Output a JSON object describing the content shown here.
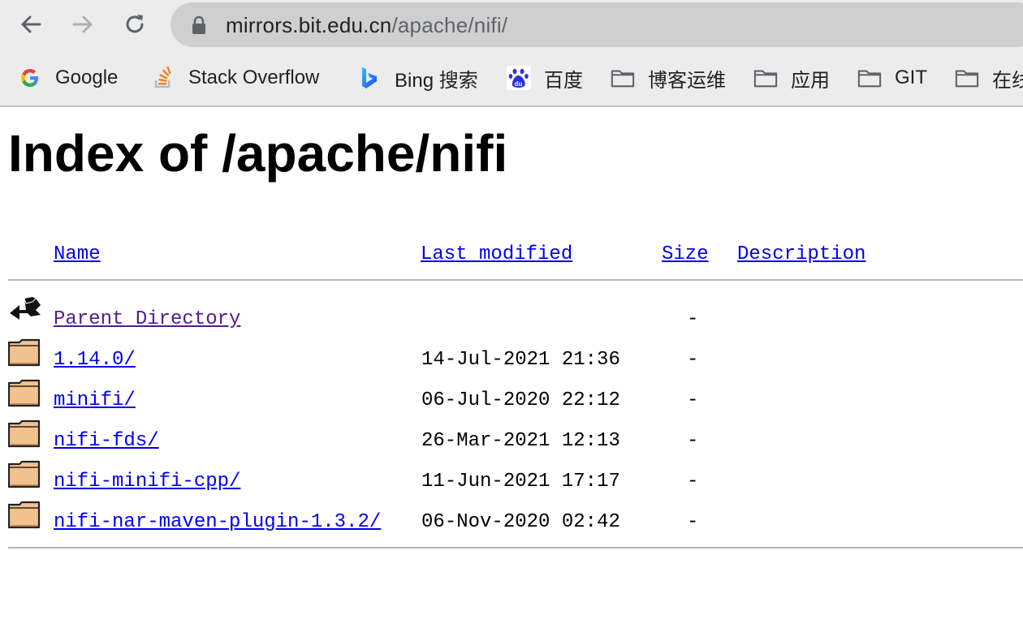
{
  "browser": {
    "url_host": "mirrors.bit.edu.cn",
    "url_path": "/apache/nifi/",
    "bookmarks": [
      {
        "label": "Google",
        "icon": "google-icon"
      },
      {
        "label": "Stack Overflow",
        "icon": "stackoverflow-icon"
      },
      {
        "label": "Bing 搜索",
        "icon": "bing-icon"
      },
      {
        "label": "百度",
        "icon": "baidu-icon"
      },
      {
        "label": "博客运维",
        "icon": "folder-icon"
      },
      {
        "label": "应用",
        "icon": "folder-icon"
      },
      {
        "label": "GIT",
        "icon": "folder-icon"
      },
      {
        "label": "在线",
        "icon": "folder-icon"
      }
    ]
  },
  "page": {
    "title": "Index of /apache/nifi",
    "columns": {
      "name": "Name",
      "last_modified": "Last modified",
      "size": "Size",
      "description": "Description"
    },
    "rows": [
      {
        "name": "Parent Directory",
        "date": "",
        "size": "-",
        "icon": "parent-directory-icon"
      },
      {
        "name": "1.14.0/",
        "date": "14-Jul-2021 21:36",
        "size": "-",
        "icon": "folder-icon"
      },
      {
        "name": "minifi/",
        "date": "06-Jul-2020 22:12",
        "size": "-",
        "icon": "folder-icon"
      },
      {
        "name": "nifi-fds/",
        "date": "26-Mar-2021 12:13",
        "size": "-",
        "icon": "folder-icon"
      },
      {
        "name": "nifi-minifi-cpp/",
        "date": "11-Jun-2021 17:17",
        "size": "-",
        "icon": "folder-icon"
      },
      {
        "name": "nifi-nar-maven-plugin-1.3.2/",
        "date": "06-Nov-2020 02:42",
        "size": "-",
        "icon": "folder-icon"
      }
    ]
  },
  "colors": {
    "link": "#0000ee",
    "visited_link": "#551a8b",
    "chrome_bg": "#ececec",
    "urlbar_bg": "#cfcfcf"
  }
}
